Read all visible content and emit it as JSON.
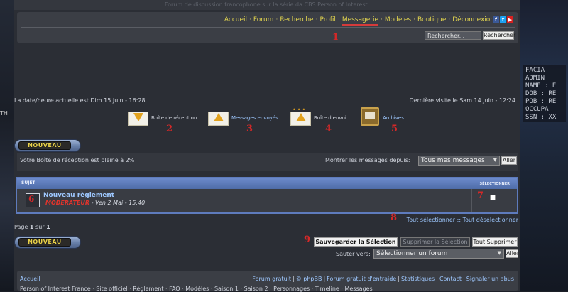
{
  "header": {
    "subtitle": "Forum de discussion francophone sur la série da CBS Person of Interest."
  },
  "nav": {
    "items": [
      "Accueil",
      "Forum",
      "Recherche",
      "Profil",
      "Messagerie",
      "Modèles",
      "Boutique",
      "Déconnexion"
    ],
    "active": "Messagerie",
    "social": [
      "f",
      "t",
      "▶"
    ]
  },
  "search": {
    "placeholder": "Rechercher...",
    "button": "Rechercher"
  },
  "side_panel": {
    "bio": "FACIA\nADMIN\nNAME : E\nDOB : RE\nPOB : RE\nOCCUPA\nSSN : XX"
  },
  "status": {
    "current_time": "La date/heure actuelle est Dim 15 Juin - 16:28",
    "last_visit": "Dernière visite le Sam 14 Juin - 12:24"
  },
  "folders": [
    {
      "label": "Boîte de réception",
      "icon": "inbox-icon",
      "num": "2"
    },
    {
      "label": "Messages envoyés",
      "icon": "sent-icon",
      "num": "3"
    },
    {
      "label": "Boîte d'envoi",
      "icon": "outbox-icon",
      "num": "4"
    },
    {
      "label": "Archives",
      "icon": "archives-icon",
      "num": "5"
    }
  ],
  "nouveau_label": "NOUVEAU",
  "inbox": {
    "fullness": "Votre Boîte de réception est pleine à 2%",
    "show_since_label": "Montrer les messages depuis:",
    "show_since_value": "Tous mes messages",
    "go_button": "Aller"
  },
  "table": {
    "col_subject": "SUJET",
    "col_select": "SÉLECTIONNER",
    "rows": [
      {
        "title": "Nouveau règlement",
        "role": "MODERATEUR",
        "date": " - Ven 2 Mai - 15:40"
      }
    ]
  },
  "select_all": "Tout sélectionner",
  "select_sep": " :: ",
  "deselect_all": "Tout désélectionner",
  "pagination": {
    "prefix": "Page ",
    "current": "1",
    "middle": " sur ",
    "total": "1"
  },
  "actions": {
    "save": "Sauvegarder la Sélection",
    "delete": "Supprimer la Sélection",
    "delete_all": "Tout Supprimer"
  },
  "jump": {
    "label": "Sauter vers:",
    "value": "Sélectionner un forum",
    "go_button": "Aller"
  },
  "annotations": [
    "1",
    "2",
    "3",
    "4",
    "5",
    "6",
    "7",
    "8",
    "9"
  ],
  "footer": {
    "home": "Accueil",
    "links": [
      "Forum gratuit",
      "© phpBB",
      "Forum gratuit d'entraide",
      "Statistiques",
      "Contact",
      "Signaler un abus"
    ],
    "bottom_links": "Person of Interest France  ·  Site officiel  ·  Règlement  ·  FAQ  ·  Modèles  ·  Saison 1  ·  Saison 2  ·  Personnages  ·  Timeline  ·  Messages"
  },
  "colors": {
    "nav_link": "#e0d34f",
    "active_underline": "#d63b3b",
    "annotation_red": "#d42828",
    "link_blue": "#9ec8ff",
    "table_header": "#5e7bbd"
  }
}
